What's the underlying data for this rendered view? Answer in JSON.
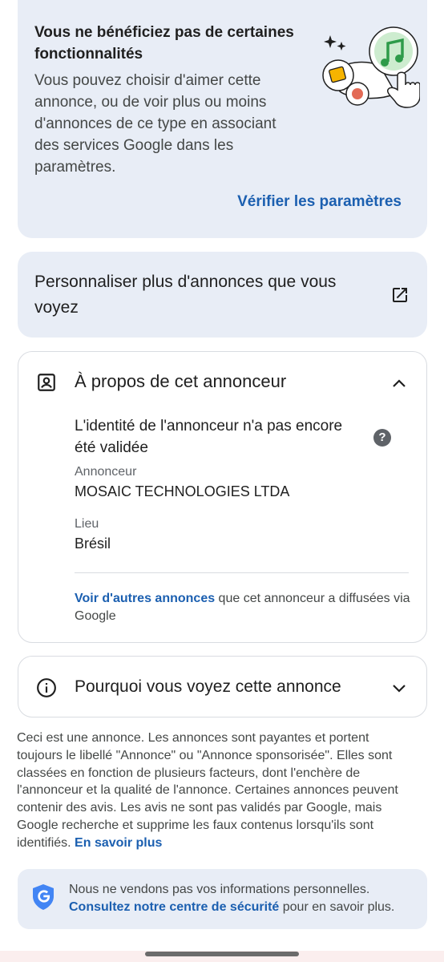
{
  "missing_features": {
    "title": "Vous ne bénéficiez pas de certaines fonctionnalités",
    "description": "Vous pouvez choisir d'aimer cette annonce, ou de voir plus ou moins d'annonces de ce type en associant des services Google dans les paramètres.",
    "link_label": "Vérifier les paramètres",
    "illustration_icon": "music-note-hand-illustration"
  },
  "personalize": {
    "label": "Personnaliser plus d'annonces que vous voyez",
    "icon": "open-in-new-icon"
  },
  "about": {
    "title": "À propos de cet annonceur",
    "identity_note": "L'identité de l'annonceur n'a pas encore été validée",
    "help_glyph": "?",
    "advertiser_label": "Annonceur",
    "advertiser_value": "MOSAIC TECHNOLOGIES LTDA",
    "location_label": "Lieu",
    "location_value": "Brésil",
    "more_link": "Voir d'autres annonces",
    "more_text": " que cet annonceur a diffusées via Google"
  },
  "why": {
    "label": "Pourquoi vous voyez cette annonce"
  },
  "disclaimer": {
    "text": "Ceci est une annonce. Les annonces sont payantes et portent toujours le libellé \"Annonce\" ou \"Annonce sponsorisée\". Elles sont classées en fonction de plusieurs facteurs, dont l'enchère de l'annonceur et la qualité de l'annonce. Certaines annonces peuvent contenir des avis. Les avis ne sont pas validés par Google, mais Google recherche et supprime les faux contenus lorsqu'ils sont identifiés. ",
    "link": "En savoir plus"
  },
  "safety": {
    "line1": "Nous ne vendons pas vos informations personnelles.",
    "link": "Consultez notre centre de sécurité",
    "line2_rest": " pour en savoir plus."
  },
  "colors": {
    "card_bg": "#e8edf6",
    "link": "#1b5fb0",
    "text": "#1f1f1f",
    "muted": "#444746",
    "google_blue": "#4285f4"
  }
}
